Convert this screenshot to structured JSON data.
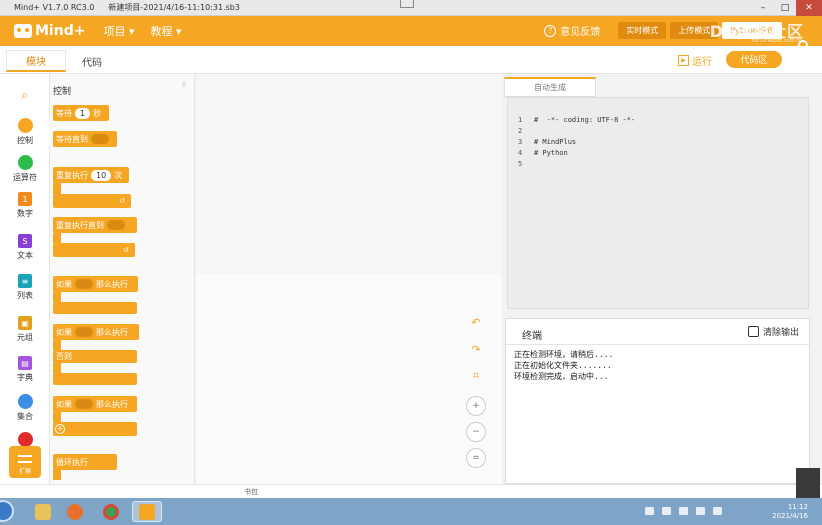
{
  "window": {
    "title": "Mind+ V1.7.0 RC3.0",
    "file": "新建项目-2021/4/16-11:10:31.sb3",
    "minimize": "–",
    "maximize": "□",
    "close": "✕"
  },
  "header": {
    "logo": "Mind+",
    "menu": [
      "项目 ▾",
      "教程 ▾"
    ],
    "feedback": "意见反馈",
    "modes": [
      "实时模式",
      "上传模式",
      "Python模式"
    ],
    "brand": "DF创客社区",
    "brand_sub": "mc.DFRobot.com.cn"
  },
  "tabs": {
    "blocks": "模块",
    "code": "代码",
    "run": "运行",
    "code_area": "代码区"
  },
  "categories": [
    {
      "label": "",
      "icon": "search-icon"
    },
    {
      "label": "控制",
      "color": "#f5a623"
    },
    {
      "label": "运算符",
      "color": "#2ebd4c"
    },
    {
      "label": "数字",
      "color": "#f08a1c"
    },
    {
      "label": "文本",
      "color": "#8a3fd1"
    },
    {
      "label": "列表",
      "color": "#19a3b8"
    },
    {
      "label": "元组",
      "color": "#e3a21a"
    },
    {
      "label": "字典",
      "color": "#a455e0"
    },
    {
      "label": "集合",
      "color": "#3a8fe3"
    }
  ],
  "extension": "扩展",
  "palette": {
    "title": "控制",
    "pin": "⤒",
    "blocks": {
      "wait_pre": "等待",
      "wait_val": "1",
      "wait_post": "秒",
      "wait_until": "等待直到",
      "repeat_pre": "重复执行",
      "repeat_val": "10",
      "repeat_post": "次",
      "repeat_until": "重复执行直到",
      "if1_pre": "如果",
      "if1_post": "那么执行",
      "if2_pre": "如果",
      "if2_post": "那么执行",
      "else": "否则",
      "if3_pre": "如果",
      "if3_post": "那么执行",
      "loop": "循环执行",
      "loop_arrow": "↺"
    }
  },
  "code": {
    "tab": "自动生成",
    "lines": [
      {
        "n": "1",
        "t": "#  -*- coding: UTF-8 -*-"
      },
      {
        "n": "2",
        "t": ""
      },
      {
        "n": "3",
        "t": "# MindPlus"
      },
      {
        "n": "4",
        "t": "# Python"
      },
      {
        "n": "5",
        "t": ""
      }
    ]
  },
  "terminal": {
    "title": "终端",
    "clear": "清除输出",
    "lines": [
      "正在检测环境，请稍后....",
      "正在初始化文件夹.......",
      "环境检测完成，启动中..."
    ]
  },
  "bottom": {
    "backpack": "书包"
  },
  "taskbar": {
    "time": "11:12",
    "date": "2021/4/16"
  }
}
